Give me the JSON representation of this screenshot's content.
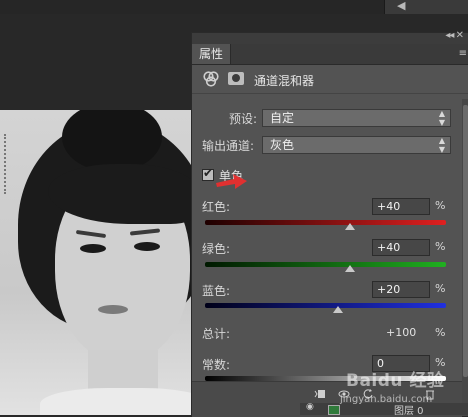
{
  "panel": {
    "tab_label": "属性",
    "adjustment_title": "通道混和器",
    "preset": {
      "label": "预设:",
      "value": "自定"
    },
    "output_channel": {
      "label": "输出通道:",
      "value": "灰色"
    },
    "monochrome": {
      "label": "单色",
      "checked": true
    },
    "channels": [
      {
        "label": "红色:",
        "value": "+40",
        "percent": "%",
        "slider_percent": 40,
        "track_color": "#e02020"
      },
      {
        "label": "绿色:",
        "value": "+40",
        "percent": "%",
        "slider_percent": 40,
        "track_color": "#20b020"
      },
      {
        "label": "蓝色:",
        "value": "+20",
        "percent": "%",
        "slider_percent": 20,
        "track_color": "#2030e0"
      }
    ],
    "total": {
      "label": "总计:",
      "value": "+100",
      "percent": "%"
    },
    "constant": {
      "label": "常数:",
      "value": "0",
      "percent": "%",
      "slider_percent": 0
    }
  },
  "layers": {
    "row_name": "图层 0"
  },
  "watermark": {
    "brand": "Baidu 经验",
    "url": "jingyan.baidu.com"
  },
  "colors": {
    "panel_bg": "#535353",
    "annotation_arrow": "#e03030"
  },
  "icons": [
    "double-arrow-icon",
    "panel-menu-icon",
    "channel-mixer-icon",
    "layer-mask-icon",
    "checkmark-icon",
    "clip-icon",
    "visibility-icon",
    "reset-icon",
    "delete-icon"
  ]
}
